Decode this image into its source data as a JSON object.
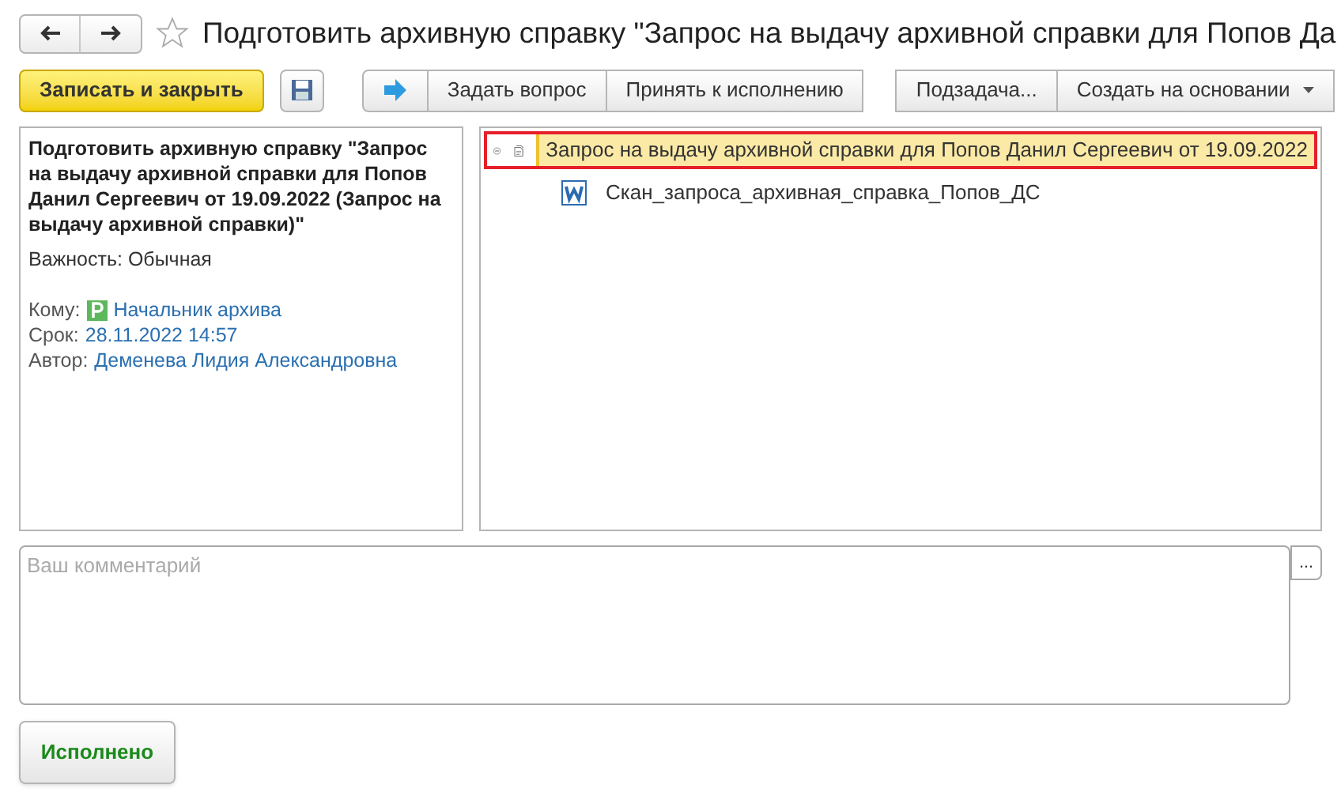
{
  "window": {
    "title": "Подготовить архивную справку \"Запрос на выдачу архивной справки для Попов Да",
    "favorite": false
  },
  "toolbar": {
    "primary": "Записать и закрыть",
    "group1": [
      "Задать вопрос",
      "Принять к исполнению"
    ],
    "group2": [
      "Подзадача...",
      "Создать на основании"
    ]
  },
  "task": {
    "title": "Подготовить архивную справку \"Запрос на выдачу архивной справки для Попов Данил Сергеевич от 19.09.2022 (Запрос на выдачу архивной справки)\"",
    "importance": "Важность: Обычная",
    "fields": [
      {
        "label": "Кому:",
        "value": "Начальник архива",
        "kind": "role"
      },
      {
        "label": "Срок:",
        "value": "28.11.2022 14:57",
        "kind": "date"
      },
      {
        "label": "Автор:",
        "value": "Деменева Лидия Александровна",
        "kind": "person"
      }
    ]
  },
  "tree": [
    {
      "label": "Запрос на выдачу архивной справки для Попов Данил Сергеевич от 19.09.2022",
      "kind": "document",
      "selected": true,
      "expanded": true,
      "children": [
        {
          "label": "Скан_запроса_архивная_справка_Попов_ДС",
          "kind": "word",
          "selected": false
        }
      ]
    }
  ],
  "comment": {
    "placeholder": "Ваш комментарий",
    "more": "..."
  },
  "done_button": "Исполнено"
}
